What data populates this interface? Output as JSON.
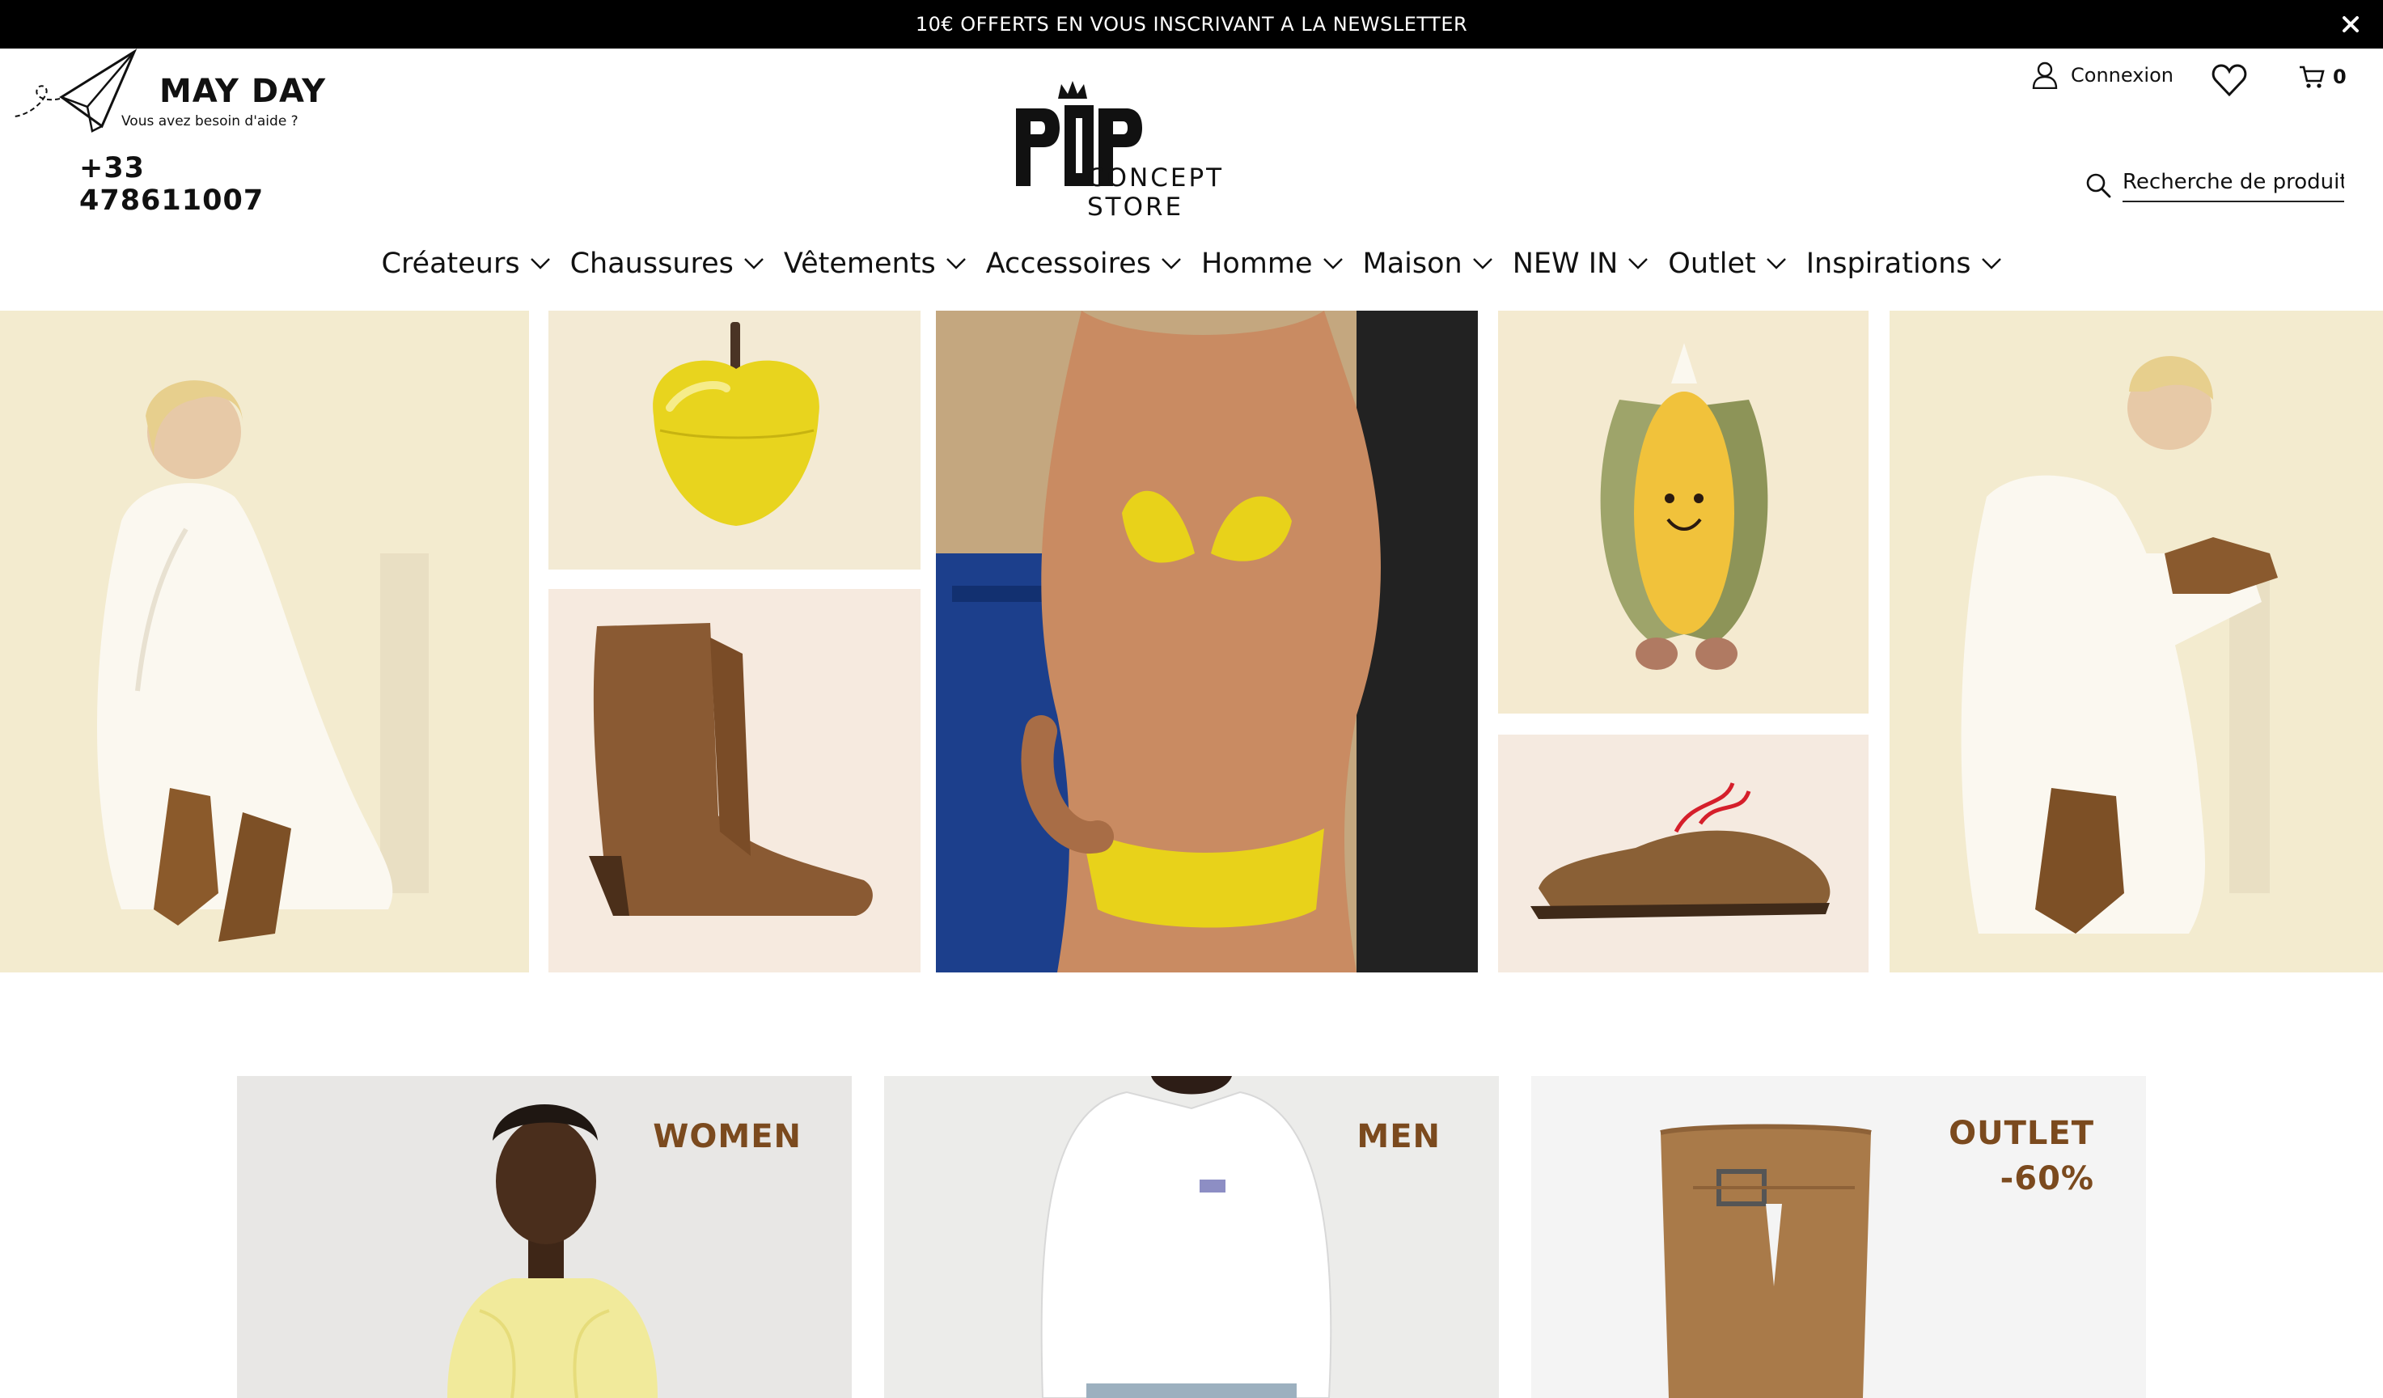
{
  "announcement": {
    "text": "10€ OFFERTS EN VOUS INSCRIVANT A LA NEWSLETTER",
    "close_icon": "close-icon"
  },
  "header": {
    "mayday": {
      "title": "MAY DAY",
      "subtitle": "Vous avez besoin d'aide ?",
      "phone": "+33 478611007"
    },
    "logo": {
      "text": "CONCEPT STORE"
    },
    "account": {
      "label": "Connexion",
      "icon": "user-icon"
    },
    "wishlist": {
      "icon": "heart-icon"
    },
    "cart": {
      "count": "0",
      "icon": "cart-icon"
    },
    "search": {
      "placeholder": "Recherche de produit",
      "icon": "search-icon"
    }
  },
  "nav": {
    "items": [
      {
        "label": "Créateurs"
      },
      {
        "label": "Chaussures"
      },
      {
        "label": "Vêtements"
      },
      {
        "label": "Accessoires"
      },
      {
        "label": "Homme"
      },
      {
        "label": "Maison"
      },
      {
        "label": "NEW IN"
      },
      {
        "label": "Outlet"
      },
      {
        "label": "Inspirations"
      }
    ]
  },
  "collage": {
    "tiles": [
      {
        "subject": "woman-white-dress-cowboy-boots"
      },
      {
        "subject": "yellow-apple-box"
      },
      {
        "subject": "fringe-suede-boot"
      },
      {
        "subject": "yellow-bikini"
      },
      {
        "subject": "corn-plush-toy"
      },
      {
        "subject": "suede-mule-red-laces"
      },
      {
        "subject": "woman-white-dress-seated"
      }
    ]
  },
  "categories": [
    {
      "label": "WOMEN"
    },
    {
      "label": "MEN"
    },
    {
      "label_line1": "OUTLET",
      "label_line2": "-60%"
    }
  ],
  "colors": {
    "announcement_bg": "#000000",
    "accent_brown": "#7b4a1e",
    "tile_cream": "#f3ead2",
    "bikini_yellow": "#e8d21a"
  }
}
